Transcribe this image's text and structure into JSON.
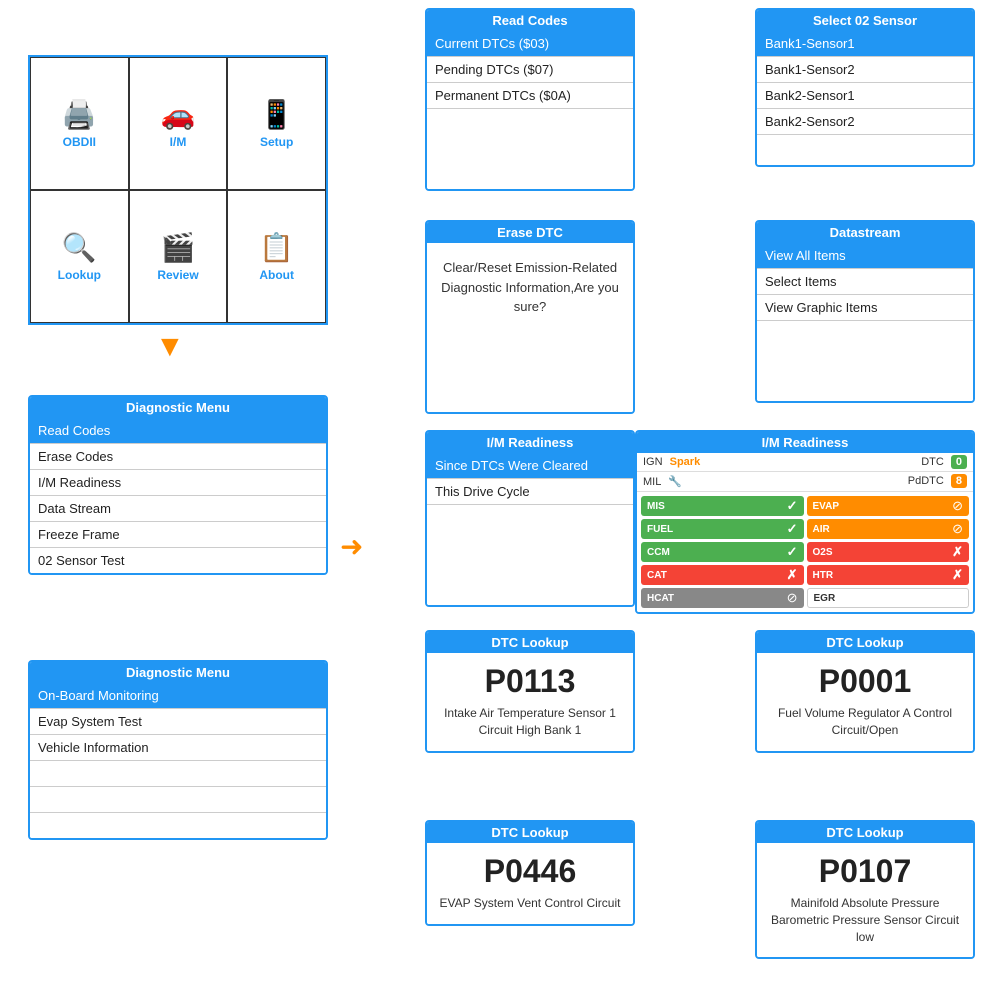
{
  "mainMenu": {
    "cells": [
      {
        "icon": "🖨️",
        "label": "OBDII",
        "active": false
      },
      {
        "icon": "🚗",
        "label": "I/M",
        "active": false
      },
      {
        "icon": "📱",
        "label": "Setup",
        "active": false
      },
      {
        "icon": "🔍",
        "label": "Lookup",
        "active": false
      },
      {
        "icon": "🎬",
        "label": "Review",
        "active": false
      },
      {
        "icon": "📋",
        "label": "About",
        "active": false
      }
    ]
  },
  "diagMenu1": {
    "header": "Diagnostic Menu",
    "items": [
      {
        "label": "Read Codes",
        "selected": true
      },
      {
        "label": "Erase Codes",
        "selected": false
      },
      {
        "label": "I/M Readiness",
        "selected": false
      },
      {
        "label": "Data Stream",
        "selected": false
      },
      {
        "label": "Freeze Frame",
        "selected": false
      },
      {
        "label": "02 Sensor Test",
        "selected": false
      }
    ]
  },
  "diagMenu2": {
    "header": "Diagnostic Menu",
    "items": [
      {
        "label": "On-Board Monitoring",
        "selected": true
      },
      {
        "label": "Evap System Test",
        "selected": false
      },
      {
        "label": "Vehicle Information",
        "selected": false
      },
      {
        "label": "",
        "selected": false
      },
      {
        "label": "",
        "selected": false
      },
      {
        "label": "",
        "selected": false
      }
    ]
  },
  "readCodes": {
    "header": "Read Codes",
    "items": [
      {
        "label": "Current DTCs ($03)",
        "selected": true
      },
      {
        "label": "Pending DTCs ($07)",
        "selected": false
      },
      {
        "label": "Permanent DTCs ($0A)",
        "selected": false
      }
    ]
  },
  "selectO2": {
    "header": "Select 02 Sensor",
    "items": [
      {
        "label": "Bank1-Sensor1",
        "selected": true
      },
      {
        "label": "Bank1-Sensor2",
        "selected": false
      },
      {
        "label": "Bank2-Sensor1",
        "selected": false
      },
      {
        "label": "Bank2-Sensor2",
        "selected": false
      }
    ]
  },
  "eraseDTC": {
    "header": "Erase DTC",
    "text": "Clear/Reset Emission-Related Diagnostic Information,Are you sure?"
  },
  "datastream": {
    "header": "Datastream",
    "items": [
      {
        "label": "View All Items",
        "selected": true
      },
      {
        "label": "Select Items",
        "selected": false
      },
      {
        "label": "View Graphic Items",
        "selected": false
      }
    ]
  },
  "imReadinessSmall": {
    "header": "I/M Readiness",
    "items": [
      {
        "label": "Since DTCs Were Cleared",
        "selected": true
      },
      {
        "label": "This Drive Cycle",
        "selected": false
      }
    ]
  },
  "imReadinessLarge": {
    "header": "I/M Readiness",
    "topRow": [
      {
        "label": "IGN",
        "value": "Spark",
        "valueColor": "#FF8C00"
      },
      {
        "label": "DTC",
        "value": "0",
        "valueColor": "#4CAF50"
      }
    ],
    "midRow": [
      {
        "label": "MIL",
        "icon": "wrench"
      },
      {
        "label": "PdDTC",
        "value": "8",
        "valueColor": "#FF8C00"
      }
    ],
    "cells": [
      {
        "label": "MIS",
        "bg": "#4CAF50",
        "status": "✓"
      },
      {
        "label": "EVAP",
        "bg": "#FF8C00",
        "status": "⊘"
      },
      {
        "label": "FUEL",
        "bg": "#4CAF50",
        "status": "✓"
      },
      {
        "label": "AIR",
        "bg": "#FF8C00",
        "status": "⊘"
      },
      {
        "label": "CCM",
        "bg": "#4CAF50",
        "status": "✓"
      },
      {
        "label": "O2S",
        "bg": "#f44336",
        "status": "✗"
      },
      {
        "label": "CAT",
        "bg": "#f44336",
        "status": "✗"
      },
      {
        "label": "HTR",
        "bg": "#f44336",
        "status": "✗"
      },
      {
        "label": "HCAT",
        "bg": "#888",
        "status": "⊘"
      },
      {
        "label": "EGR",
        "bg": "#fff",
        "status": ""
      }
    ]
  },
  "dtcLookup1": {
    "header": "DTC Lookup",
    "code": "P0113",
    "description": "Intake Air Temperature Sensor 1 Circuit High Bank 1"
  },
  "dtcLookup2": {
    "header": "DTC Lookup",
    "code": "P0001",
    "description": "Fuel Volume Regulator A Control Circuit/Open"
  },
  "dtcLookup3": {
    "header": "DTC Lookup",
    "code": "P0446",
    "description": "EVAP System Vent Control Circuit"
  },
  "dtcLookup4": {
    "header": "DTC Lookup",
    "code": "P0107",
    "description": "Mainifold Absolute Pressure Barometric Pressure Sensor Circuit low"
  },
  "arrows": {
    "down": "▼",
    "right": "➜"
  }
}
